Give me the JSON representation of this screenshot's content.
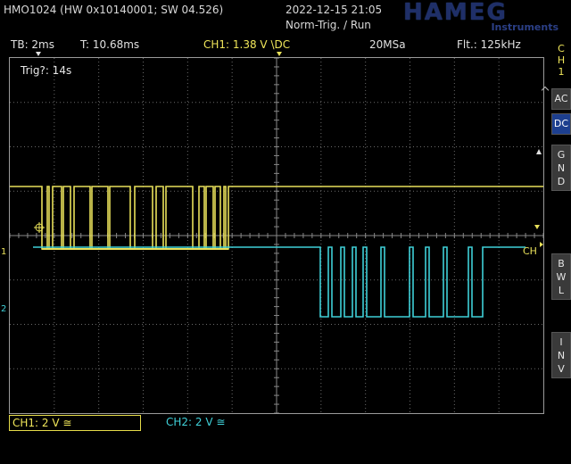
{
  "header": {
    "device": "HMO1024 (HW 0x10140001; SW 04.526)",
    "datetime": "2022-12-15 21:05",
    "trigger_state": "Norm-Trig. / Run",
    "logo_main": "HAMEG",
    "logo_sub": "Instruments"
  },
  "info": {
    "timebase": "TB: 2ms",
    "time_offset": "T: 10.68ms",
    "ch1_trigger": "CH1: 1.38 V \\DC",
    "sample_rate": "20MSa",
    "filter": "Flt.: 125kHz"
  },
  "scope": {
    "trig_status": "Trig?: 14s",
    "ch1_marker": "1",
    "ch2_marker": "2",
    "ch_right_label": "CH"
  },
  "side_menu": {
    "channel": [
      "C",
      "H",
      "1"
    ],
    "ac": "AC",
    "dc": "DC",
    "gnd": [
      "G",
      "N",
      "D"
    ],
    "bwl": [
      "B",
      "W",
      "L"
    ],
    "inv": [
      "I",
      "N",
      "V"
    ]
  },
  "footer": {
    "ch1": "CH1: 2 V ≅",
    "ch2": "CH2: 2 V ≅"
  },
  "colors": {
    "ch1": "#e8e05a",
    "ch2": "#3fd0d8",
    "grid": "#6a6a6a",
    "accent": "#1d3f8f"
  }
}
